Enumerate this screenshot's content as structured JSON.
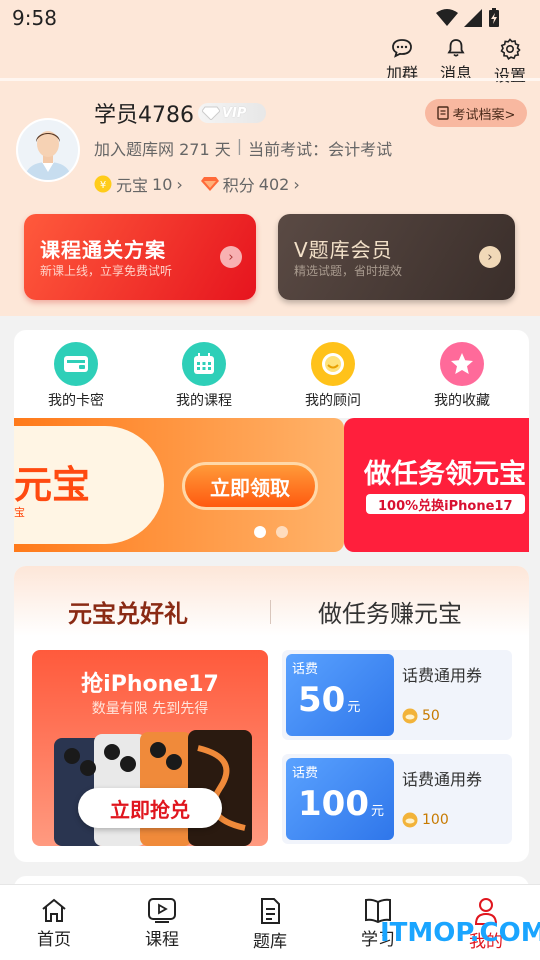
{
  "status": {
    "time": "9:58"
  },
  "header": {
    "actions": [
      {
        "label": "加群",
        "icon": "chat-icon"
      },
      {
        "label": "消息",
        "icon": "bell-icon"
      },
      {
        "label": "设置",
        "icon": "gear-icon"
      }
    ]
  },
  "profile": {
    "username": "学员4786",
    "vip_label": "VIP",
    "exam_record_label": "考试档案>",
    "join_text": "加入题库网 271 天",
    "current_exam": "当前考试：会计考试",
    "yuanbao_label": "元宝",
    "yuanbao_value": "10",
    "points_label": "积分",
    "points_value": "402",
    "chevron": "›"
  },
  "promo_cards": [
    {
      "title": "课程通关方案",
      "subtitle": "新课上线，立享免费试听"
    },
    {
      "title": "V题库会员",
      "subtitle": "精选试题，省时提效"
    }
  ],
  "quick_entries": [
    {
      "label": "我的卡密",
      "icon": "card-icon",
      "color": "#2ecfb8"
    },
    {
      "label": "我的课程",
      "icon": "calendar-icon",
      "color": "#2ecfb8"
    },
    {
      "label": "我的顾问",
      "icon": "advisor-icon",
      "color": "#ffc21a"
    },
    {
      "label": "我的收藏",
      "icon": "star-icon",
      "color": "#ff6a9a"
    }
  ],
  "banner": {
    "slide_a_big": "元宝",
    "slide_a_small": "宝",
    "slide_a_button": "立即领取",
    "slide_b_big": "做任务领元宝",
    "slide_b_pill": "100%兑换iPhone17",
    "slide_count": 2,
    "active_slide": 1
  },
  "gift": {
    "tabs": [
      "元宝兑好礼",
      "做任务赚元宝"
    ],
    "active_tab": 0,
    "iphone_title": "抢iPhone17",
    "iphone_sub": "数量有限 先到先得",
    "iphone_button": "立即抢兑",
    "vouchers": [
      {
        "tag": "话费",
        "amount": "50",
        "unit": "元",
        "name": "话费通用券",
        "cost": "50"
      },
      {
        "tag": "话费",
        "amount": "100",
        "unit": "元",
        "name": "话费通用券",
        "cost": "100"
      }
    ]
  },
  "bottom_nav": [
    {
      "label": "首页",
      "icon": "home-icon"
    },
    {
      "label": "课程",
      "icon": "play-icon"
    },
    {
      "label": "题库",
      "icon": "document-icon"
    },
    {
      "label": "学习",
      "icon": "book-icon"
    },
    {
      "label": "我的",
      "icon": "user-icon",
      "active": true
    }
  ],
  "watermark": "ITMOP.COM",
  "colors": {
    "accent": "#e0161e",
    "header_bg": "#fde7d8",
    "voucher_blue": "#2f76ea"
  }
}
